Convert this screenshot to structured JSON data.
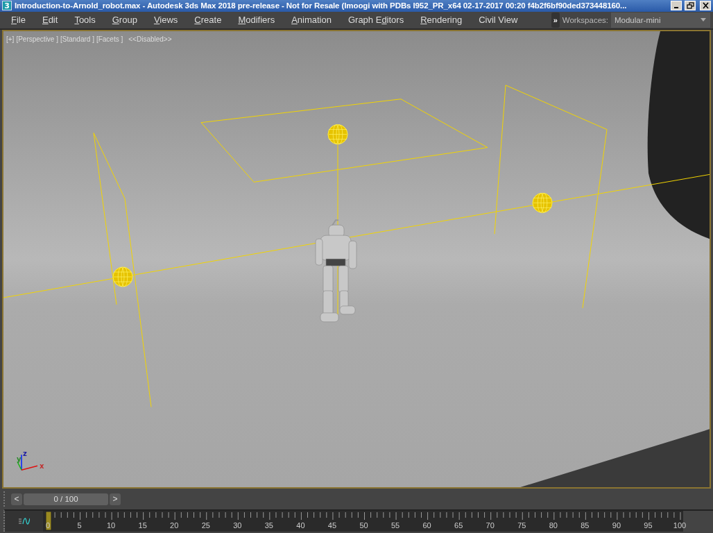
{
  "window": {
    "icon_text": "3",
    "title": "Introduction-to-Arnold_robot.max - Autodesk 3ds Max 2018 pre-release - Not for Resale (Imoogi with PDBs I952_PR_x64 02-17-2017 00:20 f4b2f6bf90ded373448160..."
  },
  "menu": [
    {
      "key": "F",
      "post": "ile"
    },
    {
      "key": "E",
      "post": "dit"
    },
    {
      "key": "T",
      "post": "ools"
    },
    {
      "key": "G",
      "post": "roup"
    },
    {
      "key": "V",
      "post": "iews"
    },
    {
      "key": "C",
      "post": "reate"
    },
    {
      "key": "M",
      "post": "odifiers"
    },
    {
      "key": "A",
      "post": "nimation"
    },
    {
      "pre": "Graph E",
      "key": "d",
      "post": "itors"
    },
    {
      "key": "R",
      "post": "endering"
    },
    {
      "pre": "Civil View"
    }
  ],
  "workspaces": {
    "overflow": "»",
    "label": "Workspaces:",
    "value": "Modular-mini"
  },
  "viewport": {
    "labels": [
      "[+]",
      "[Perspective ]",
      "[Standard ]",
      "[Facets ]",
      "<<Disabled>>"
    ],
    "axes": [
      "z",
      "y",
      "x"
    ]
  },
  "timeline": {
    "prev": "<",
    "next": ">",
    "frame_field": "0 / 100",
    "level": 0,
    "ruler_labels": [
      "0",
      "5",
      "10",
      "15",
      "20",
      "25",
      "30",
      "35",
      "40",
      "45",
      "50",
      "55",
      "60",
      "65",
      "70",
      "75",
      "80",
      "85",
      "90",
      "95",
      "100"
    ]
  }
}
